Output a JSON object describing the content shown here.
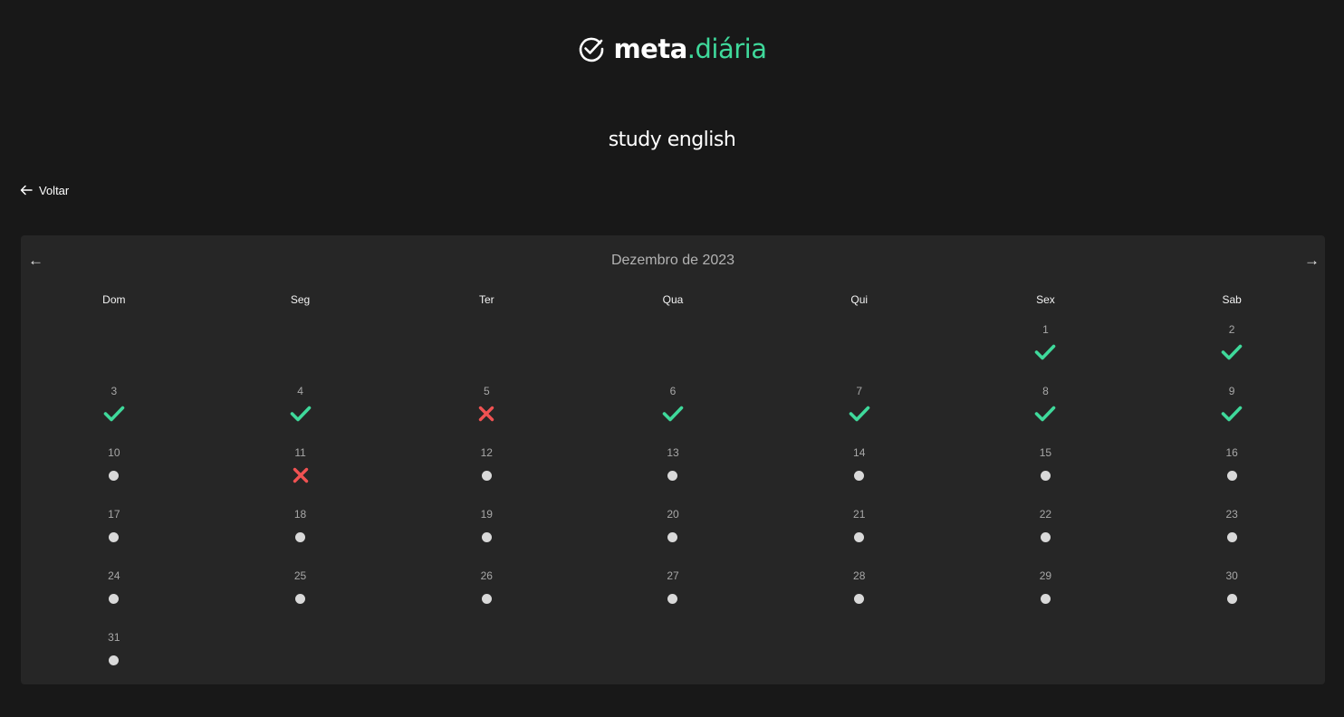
{
  "app": {
    "logo_primary": "meta",
    "logo_accent": ".diária",
    "brand_color": "#3fd99b",
    "fail_color": "#f05252"
  },
  "goal_title": "study english",
  "back": {
    "icon": "arrow-left-icon",
    "label": "Voltar"
  },
  "calendar": {
    "month_label": "Dezembro de 2023",
    "prev_icon": "←",
    "next_icon": "→",
    "weekdays": [
      "Dom",
      "Seg",
      "Ter",
      "Qua",
      "Qui",
      "Sex",
      "Sab"
    ],
    "first_weekday_index": 5,
    "days": [
      {
        "day": "1",
        "status": "done"
      },
      {
        "day": "2",
        "status": "done"
      },
      {
        "day": "3",
        "status": "done"
      },
      {
        "day": "4",
        "status": "done"
      },
      {
        "day": "5",
        "status": "missed"
      },
      {
        "day": "6",
        "status": "done"
      },
      {
        "day": "7",
        "status": "done"
      },
      {
        "day": "8",
        "status": "done"
      },
      {
        "day": "9",
        "status": "done"
      },
      {
        "day": "10",
        "status": "pending"
      },
      {
        "day": "11",
        "status": "missed"
      },
      {
        "day": "12",
        "status": "pending"
      },
      {
        "day": "13",
        "status": "pending"
      },
      {
        "day": "14",
        "status": "pending"
      },
      {
        "day": "15",
        "status": "pending"
      },
      {
        "day": "16",
        "status": "pending"
      },
      {
        "day": "17",
        "status": "pending"
      },
      {
        "day": "18",
        "status": "pending"
      },
      {
        "day": "19",
        "status": "pending"
      },
      {
        "day": "20",
        "status": "pending"
      },
      {
        "day": "21",
        "status": "pending"
      },
      {
        "day": "22",
        "status": "pending"
      },
      {
        "day": "23",
        "status": "pending"
      },
      {
        "day": "24",
        "status": "pending"
      },
      {
        "day": "25",
        "status": "pending"
      },
      {
        "day": "26",
        "status": "pending"
      },
      {
        "day": "27",
        "status": "pending"
      },
      {
        "day": "28",
        "status": "pending"
      },
      {
        "day": "29",
        "status": "pending"
      },
      {
        "day": "30",
        "status": "pending"
      },
      {
        "day": "31",
        "status": "pending"
      }
    ]
  }
}
